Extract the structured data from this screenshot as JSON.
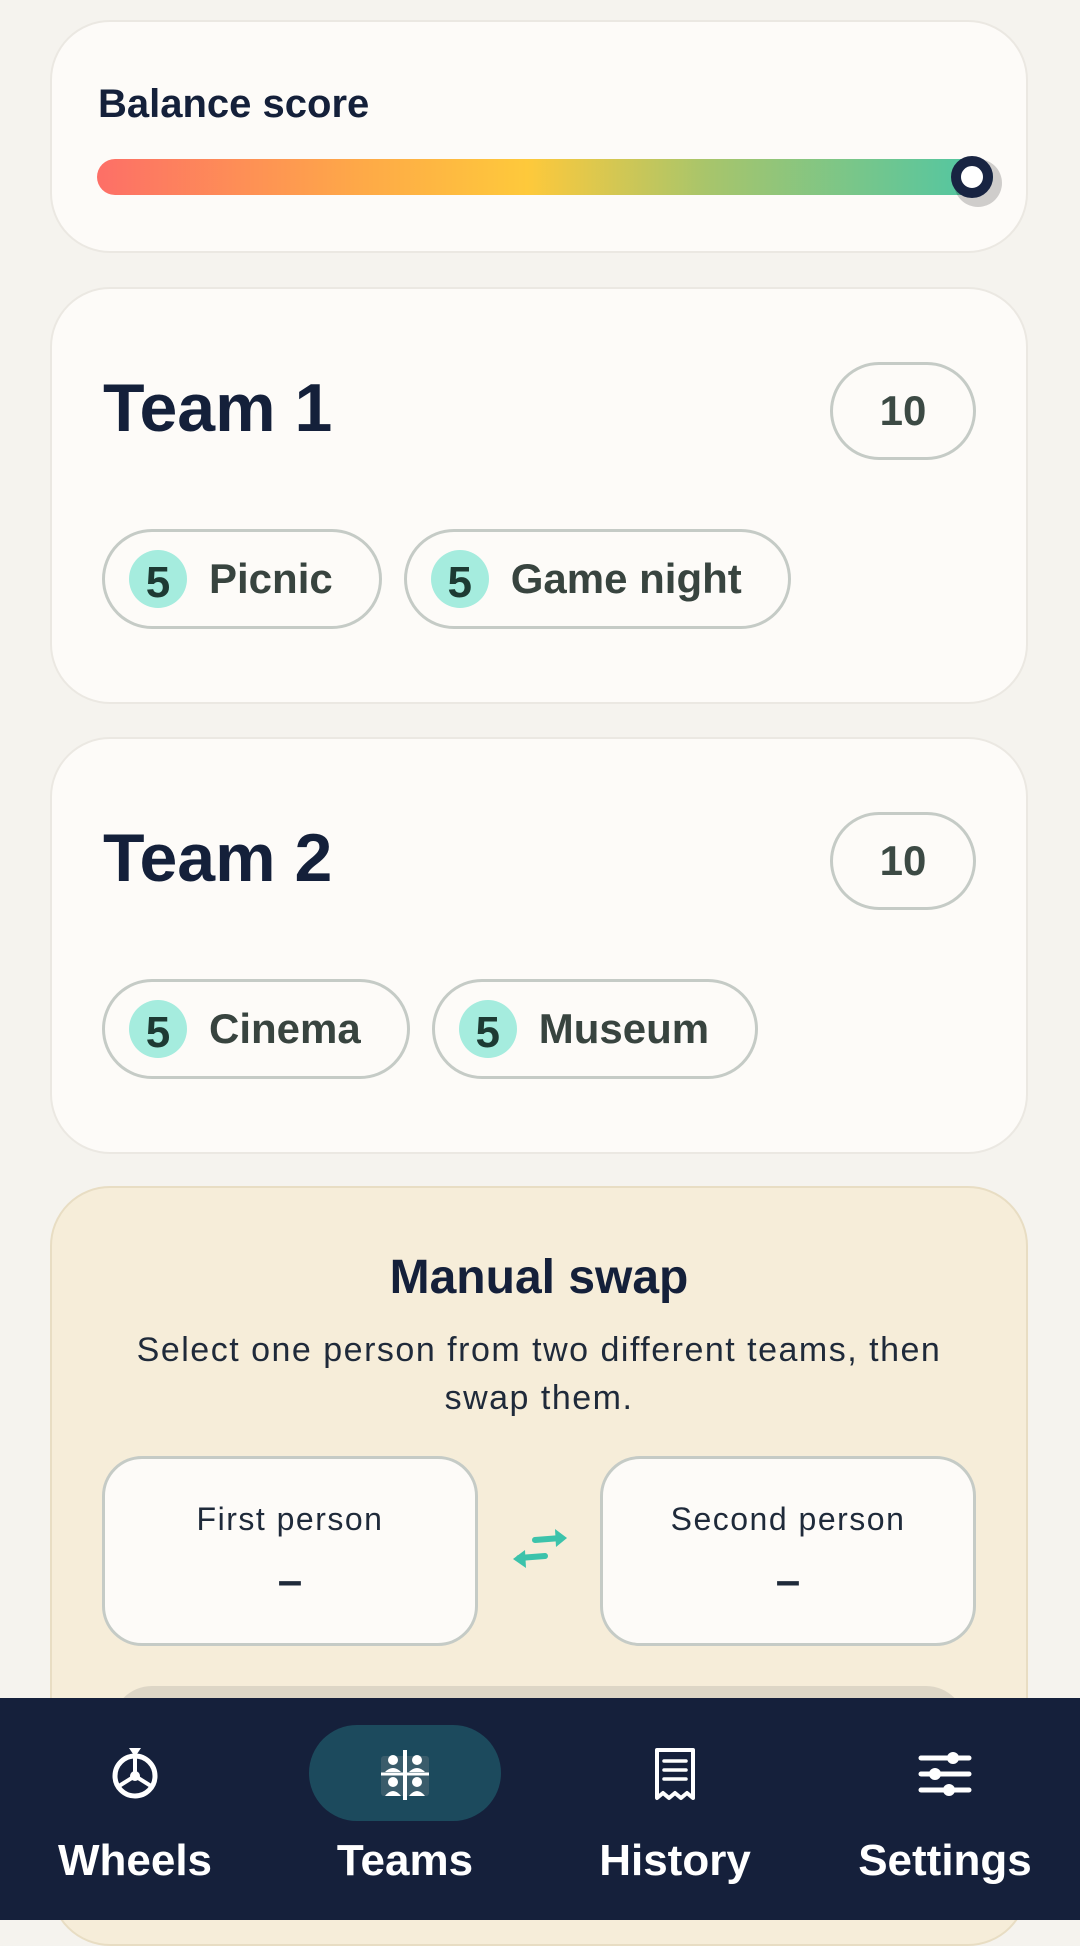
{
  "balance": {
    "title": "Balance score",
    "value": 1.0
  },
  "teams": [
    {
      "name": "Team 1",
      "count": "10",
      "activities": [
        {
          "count": "5",
          "label": "Picnic"
        },
        {
          "count": "5",
          "label": "Game night"
        }
      ]
    },
    {
      "name": "Team 2",
      "count": "10",
      "activities": [
        {
          "count": "5",
          "label": "Cinema"
        },
        {
          "count": "5",
          "label": "Museum"
        }
      ]
    }
  ],
  "manual_swap": {
    "title": "Manual swap",
    "description": "Select one person from two different teams, then swap them.",
    "first_label": "First person",
    "first_value": "–",
    "second_label": "Second person",
    "second_value": "–",
    "swap_icon": "swap-arrows-icon"
  },
  "nav": {
    "active": "Teams",
    "items": [
      {
        "label": "Wheels",
        "icon": "wheel-icon"
      },
      {
        "label": "Teams",
        "icon": "teams-icon"
      },
      {
        "label": "History",
        "icon": "receipt-icon"
      },
      {
        "label": "Settings",
        "icon": "sliders-icon"
      }
    ]
  },
  "colors": {
    "navy": "#15203b",
    "mint": "#a5ecde",
    "accent": "#3cc3ab",
    "nav_active": "#1c4a5d",
    "swap_bg": "#f6edd9"
  }
}
